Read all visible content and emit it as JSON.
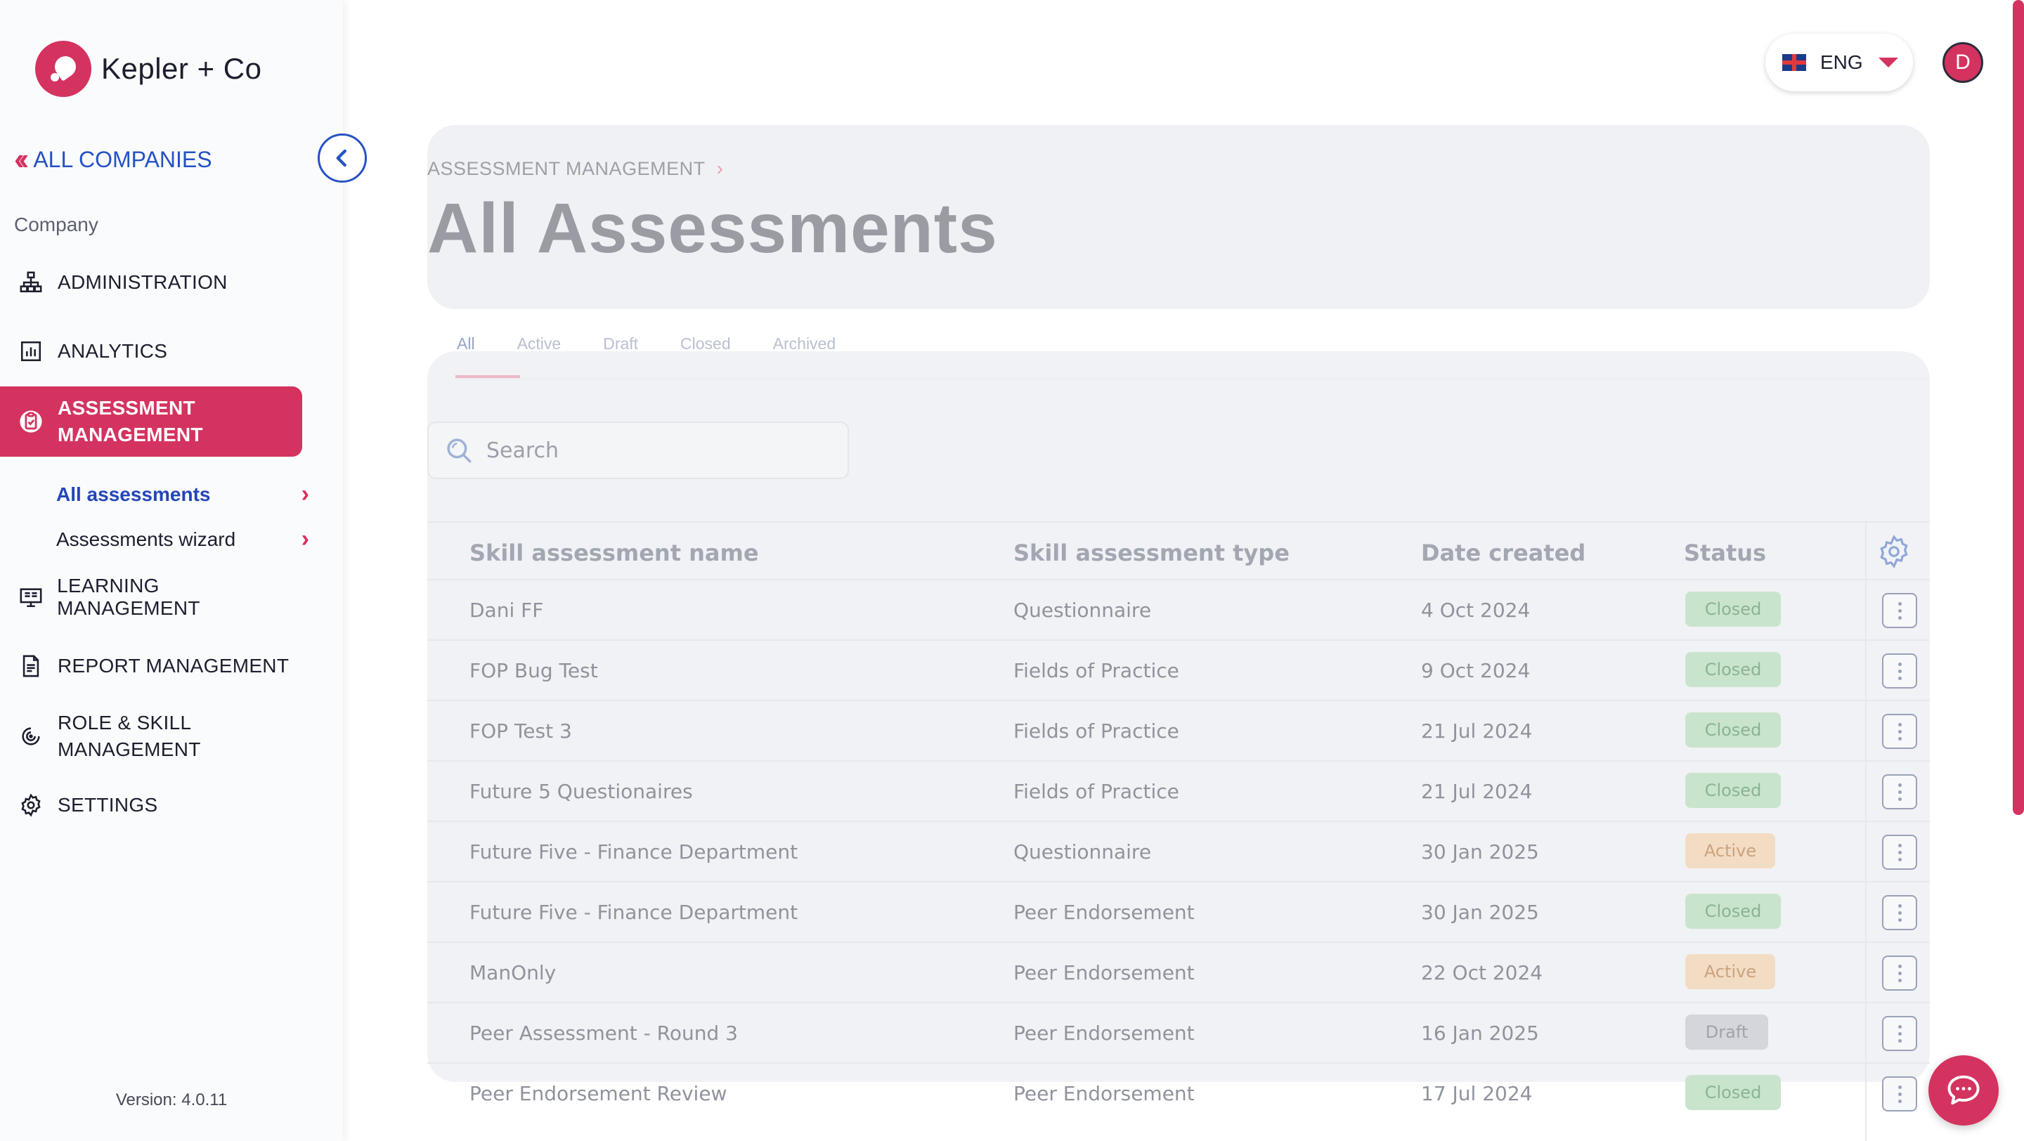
{
  "brand": {
    "name": "Kepler + Co"
  },
  "sidebar": {
    "all_companies": "ALL COMPANIES",
    "section_label": "Company",
    "items": [
      {
        "label": "ADMINISTRATION",
        "icon": "org-chart-icon"
      },
      {
        "label": "ANALYTICS",
        "icon": "bar-chart-icon"
      },
      {
        "label": "ASSESSMENT MANAGEMENT",
        "icon": "clipboard-check-icon",
        "active": true
      },
      {
        "label": "LEARNING MANAGEMENT",
        "icon": "monitor-book-icon"
      },
      {
        "label": "REPORT MANAGEMENT",
        "icon": "document-report-icon"
      },
      {
        "label": "ROLE & SKILL MANAGEMENT",
        "icon": "spiral-icon"
      },
      {
        "label": "SETTINGS",
        "icon": "gear-icon"
      }
    ],
    "sub_items": [
      {
        "label": "All assessments",
        "current": true
      },
      {
        "label": "Assessments wizard",
        "current": false
      }
    ],
    "version": "Version: 4.0.11"
  },
  "header": {
    "language": "ENG",
    "avatar_initial": "D"
  },
  "main": {
    "breadcrumb": "ASSESSMENT MANAGEMENT",
    "title": "All Assessments",
    "tabs": [
      "All",
      "Active",
      "Draft",
      "Closed",
      "Archived"
    ],
    "selected_tab": "All",
    "search_placeholder": "Search",
    "columns": [
      "Skill assessment name",
      "Skill assessment type",
      "Date created",
      "Status"
    ],
    "rows": [
      {
        "name": "Dani FF",
        "type": "Questionnaire",
        "date": "4 Oct 2024",
        "status": "Closed"
      },
      {
        "name": "FOP Bug Test",
        "type": "Fields of Practice",
        "date": "9 Oct 2024",
        "status": "Closed"
      },
      {
        "name": "FOP Test 3",
        "type": "Fields of Practice",
        "date": "21 Jul 2024",
        "status": "Closed"
      },
      {
        "name": "Future 5 Questionaires",
        "type": "Fields of Practice",
        "date": "21 Jul 2024",
        "status": "Closed"
      },
      {
        "name": "Future Five - Finance Department",
        "type": "Questionnaire",
        "date": "30 Jan 2025",
        "status": "Active"
      },
      {
        "name": "Future Five - Finance Department",
        "type": "Peer Endorsement",
        "date": "30 Jan 2025",
        "status": "Closed"
      },
      {
        "name": "ManOnly",
        "type": "Peer Endorsement",
        "date": "22 Oct 2024",
        "status": "Active"
      },
      {
        "name": "Peer Assessment - Round 3",
        "type": "Peer Endorsement",
        "date": "16 Jan 2025",
        "status": "Draft"
      },
      {
        "name": "Peer Endorsement Review",
        "type": "Peer Endorsement",
        "date": "17 Jul 2024",
        "status": "Closed"
      }
    ]
  },
  "colors": {
    "accent": "#d4335f",
    "link": "#2752c4"
  }
}
